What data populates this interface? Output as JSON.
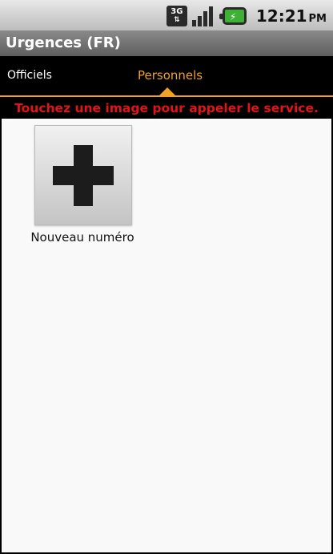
{
  "status_bar": {
    "network_type": "3G",
    "time": "12:21",
    "ampm": "PM",
    "icons": [
      "network-3g-icon",
      "signal-strength-icon",
      "battery-charging-icon"
    ],
    "battery_color": "#3fb036"
  },
  "app": {
    "title": "Urgences (FR)"
  },
  "tabs": [
    {
      "label": "Officiels",
      "selected": false
    },
    {
      "label": "Personnels",
      "selected": true
    }
  ],
  "hint": "Touchez une image pour appeler le service.",
  "items": [
    {
      "label": "Nouveau numéro",
      "icon": "plus-icon"
    }
  ],
  "colors": {
    "accent": "#f0a322",
    "hint_text": "#e4131b",
    "background": "#f9f9f9"
  }
}
